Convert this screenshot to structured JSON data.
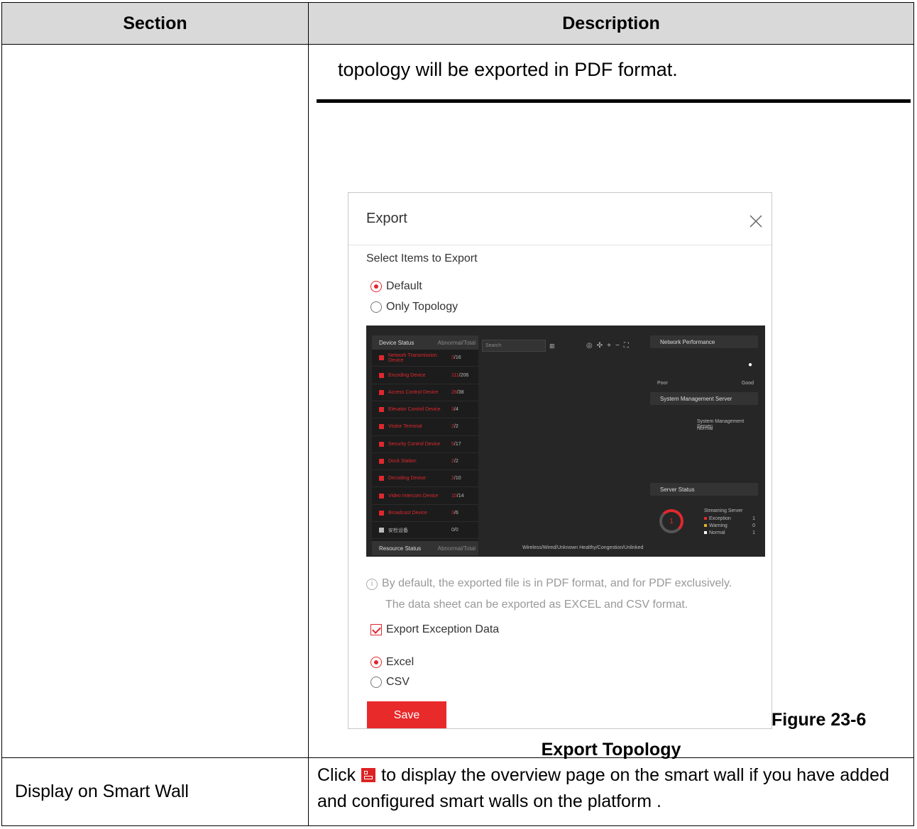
{
  "table": {
    "header": {
      "section": "Section",
      "description": "Description"
    },
    "row1": {
      "top_text": "topology will be exported in PDF format.",
      "figure_number": "Figure 23-6",
      "figure_caption": "Export Topology"
    },
    "row2": {
      "section": "Display on Smart Wall",
      "description_before_icon": "Click",
      "description_after_icon": "to display the overview page on the smart wall if you have added and configured smart walls on the platform ."
    }
  },
  "dialog": {
    "title": "Export",
    "subtitle": "Select Items to Export",
    "radio_default": "Default",
    "radio_only_topology": "Only Topology",
    "info_line1": "By default, the exported file is in PDF format, and for PDF exclusively.",
    "info_line2": "The data sheet can be exported as EXCEL and CSV format.",
    "checkbox_label": "Export Exception Data",
    "radio_excel": "Excel",
    "radio_csv": "CSV",
    "save_label": "Save",
    "accent_color": "#e82a2a"
  },
  "preview": {
    "device_status": "Device Status",
    "abnormal_total": "Abnormal/Total",
    "search_placeholder": "Search",
    "devices": [
      {
        "name": "Network Transmission Device",
        "abnormal": "3",
        "total": "/16"
      },
      {
        "name": "Encoding Device",
        "abnormal": "111",
        "total": "/206"
      },
      {
        "name": "Access Control Device",
        "abnormal": "28",
        "total": "/38"
      },
      {
        "name": "Elevator Control Device",
        "abnormal": "3",
        "total": "/4"
      },
      {
        "name": "Visitor Terminal",
        "abnormal": "2",
        "total": "/2"
      },
      {
        "name": "Security Control Device",
        "abnormal": "5",
        "total": "/17"
      },
      {
        "name": "Dock Station",
        "abnormal": "2",
        "total": "/2"
      },
      {
        "name": "Decoding Device",
        "abnormal": "2",
        "total": "/10"
      },
      {
        "name": "Video Intercom Device",
        "abnormal": "10",
        "total": "/14"
      },
      {
        "name": "Broadcast Device",
        "abnormal": "3",
        "total": "/6"
      },
      {
        "name": "安检设备",
        "abnormal": "",
        "total": "0/0"
      }
    ],
    "resource_status": "Resource Status",
    "network_performance": "Network Performance",
    "poor": "Poor",
    "good": "Good",
    "sms_header": "System Management Server",
    "sms_status_line1": "System Management Server:",
    "sms_status_line2": "Normal",
    "server_status": "Server Status",
    "streaming_server": "Streaming Server",
    "gauge_value": "1",
    "legend": [
      {
        "label": "Exception",
        "value": "1"
      },
      {
        "label": "Warning",
        "value": "0"
      },
      {
        "label": "Normal",
        "value": "1"
      }
    ],
    "bottom_text": "Wireless/Wired/Unknown  Healthy/Congestion/Unlinked"
  }
}
